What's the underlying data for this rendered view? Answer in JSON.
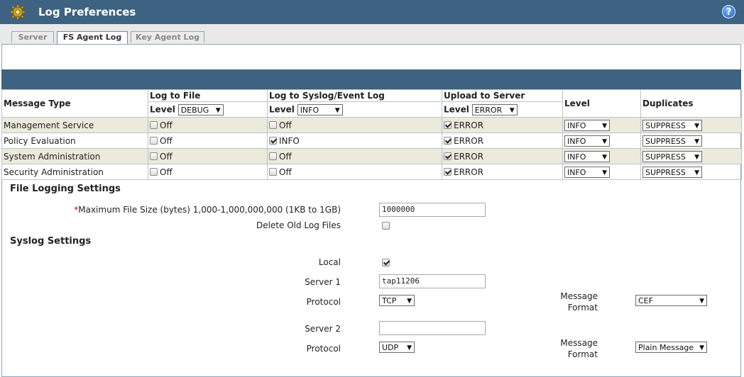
{
  "window": {
    "title": "Log Preferences"
  },
  "tabs": [
    {
      "label": "Server",
      "active": false
    },
    {
      "label": "FS Agent Log",
      "active": true
    },
    {
      "label": "Key Agent Log",
      "active": false
    }
  ],
  "table": {
    "headers": {
      "message_type": "Message Type",
      "log_to_file": "Log to File",
      "log_to_syslog": "Log to Syslog/Event Log",
      "upload_to_server": "Upload to Server",
      "level": "Level",
      "duplicates": "Duplicates"
    },
    "level_label": "Level",
    "file_level": "DEBUG",
    "syslog_level": "INFO",
    "upload_level": "ERROR",
    "rows": [
      {
        "type": "Management Service",
        "file": {
          "checked": false,
          "text": "Off"
        },
        "syslog": {
          "checked": false,
          "text": "Off"
        },
        "upload": {
          "checked": true,
          "text": "ERROR"
        },
        "level": "INFO",
        "duplicates": "SUPPRESS"
      },
      {
        "type": "Policy Evaluation",
        "file": {
          "checked": false,
          "text": "Off"
        },
        "syslog": {
          "checked": true,
          "text": "INFO"
        },
        "upload": {
          "checked": true,
          "text": "ERROR"
        },
        "level": "INFO",
        "duplicates": "SUPPRESS"
      },
      {
        "type": "System Administration",
        "file": {
          "checked": false,
          "text": "Off"
        },
        "syslog": {
          "checked": false,
          "text": "Off"
        },
        "upload": {
          "checked": true,
          "text": "ERROR"
        },
        "level": "INFO",
        "duplicates": "SUPPRESS"
      },
      {
        "type": "Security Administration",
        "file": {
          "checked": false,
          "text": "Off"
        },
        "syslog": {
          "checked": false,
          "text": "Off"
        },
        "upload": {
          "checked": true,
          "text": "ERROR"
        },
        "level": "INFO",
        "duplicates": "SUPPRESS"
      }
    ]
  },
  "file_logging": {
    "heading": "File Logging Settings",
    "required_mark": "*",
    "max_size_label": "Maximum File Size (bytes) 1,000-1,000,000,000 (1KB to 1GB)",
    "max_size_value": "1000000",
    "delete_old_label": "Delete Old Log Files",
    "delete_old_checked": false
  },
  "syslog": {
    "heading": "Syslog Settings",
    "local_label": "Local",
    "local_checked": true,
    "server1_label": "Server 1",
    "server1_value": "tap11206",
    "protocol1_label": "Protocol",
    "protocol1_value": "TCP",
    "message_label": "Message",
    "format_label": "Format",
    "format1_value": "CEF",
    "server2_label": "Server 2",
    "server2_value": "",
    "protocol2_label": "Protocol",
    "protocol2_value": "UDP",
    "format2_value": "Plain Message"
  },
  "icons": {
    "title_icon": "gear-icon",
    "help_icon": "help-icon",
    "dropdown_arrow": "▼"
  },
  "colors": {
    "header_bg": "#3d6282",
    "alt_row_bg": "#eceadb"
  }
}
